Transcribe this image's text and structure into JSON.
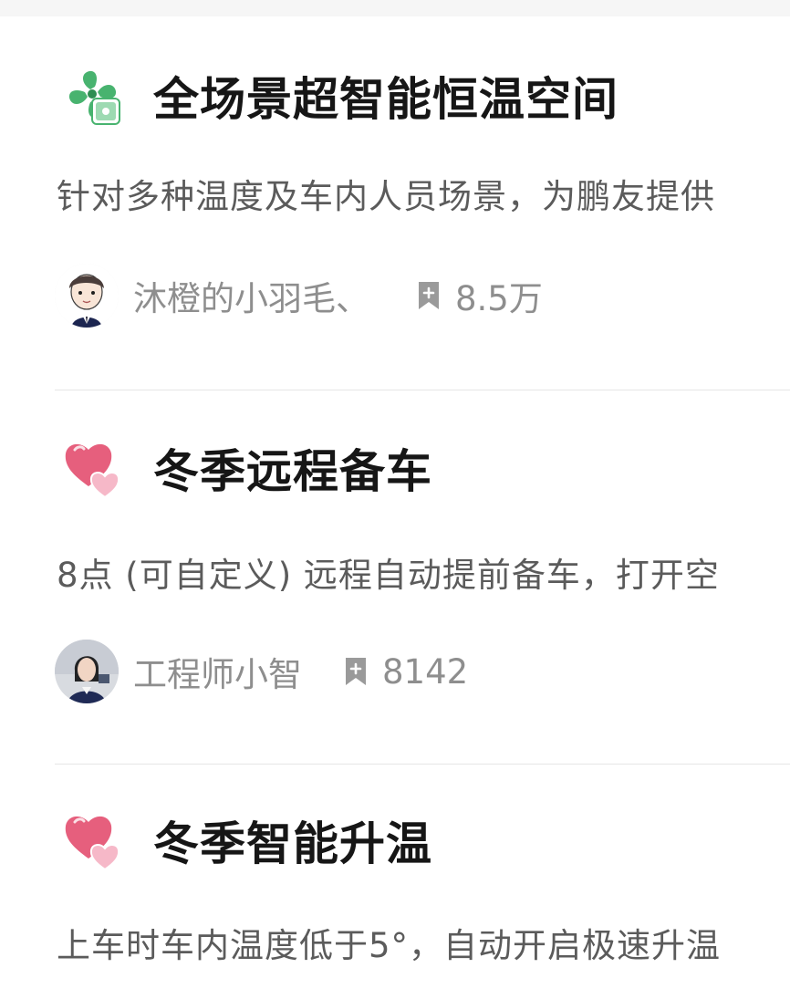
{
  "cards": [
    {
      "icon": "fan-icon",
      "title": "全场景超智能恒温空间",
      "description": "针对多种温度及车内人员场景，为鹏友提供",
      "author": "沐橙的小羽毛、",
      "count": "8.5万"
    },
    {
      "icon": "heart-icon",
      "title": "冬季远程备车",
      "description": "8点 (可自定义) 远程自动提前备车，打开空",
      "author": "工程师小智",
      "count": "8142"
    },
    {
      "icon": "heart-icon",
      "title": "冬季智能升温",
      "description": "上车时车内温度低于5°，自动开启极速升温"
    }
  ],
  "colors": {
    "title": "#161616",
    "description": "#5b5b5b",
    "meta": "#8e8e8e",
    "divider": "#e6e6e6",
    "fan_green": "#48b36f",
    "heart_pink": "#e65f7d"
  }
}
